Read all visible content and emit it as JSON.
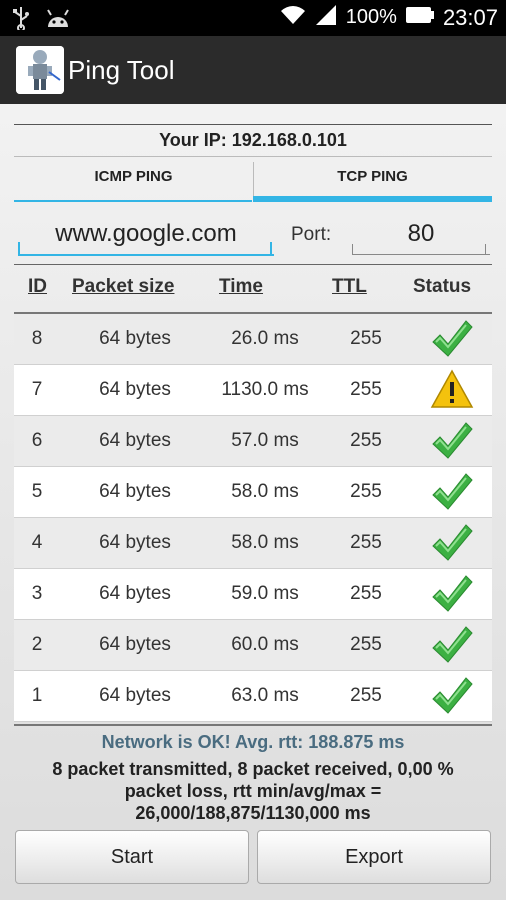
{
  "status_bar": {
    "battery_text": "100%",
    "time": "23:07",
    "icons": [
      "usb-icon",
      "android-icon",
      "wifi-icon",
      "signal-icon",
      "battery-icon"
    ]
  },
  "app": {
    "title": "Ping Tool",
    "icon_name": "robot-app-icon"
  },
  "your_ip": "Your IP: 192.168.0.101",
  "tabs": [
    {
      "label": "ICMP PING",
      "selected": false
    },
    {
      "label": "TCP PING",
      "selected": true
    }
  ],
  "host": {
    "value": "www.google.com"
  },
  "port": {
    "label": "Port:",
    "value": "80"
  },
  "table": {
    "headers": {
      "id": "ID",
      "size": "Packet size",
      "time": "Time",
      "ttl": "TTL",
      "status": "Status"
    },
    "rows": [
      {
        "id": "8",
        "size": "64 bytes",
        "time": "26.0 ms",
        "ttl": "255",
        "status": "ok"
      },
      {
        "id": "7",
        "size": "64 bytes",
        "time": "1130.0 ms",
        "ttl": "255",
        "status": "warning"
      },
      {
        "id": "6",
        "size": "64 bytes",
        "time": "57.0 ms",
        "ttl": "255",
        "status": "ok"
      },
      {
        "id": "5",
        "size": "64 bytes",
        "time": "58.0 ms",
        "ttl": "255",
        "status": "ok"
      },
      {
        "id": "4",
        "size": "64 bytes",
        "time": "58.0 ms",
        "ttl": "255",
        "status": "ok"
      },
      {
        "id": "3",
        "size": "64 bytes",
        "time": "59.0 ms",
        "ttl": "255",
        "status": "ok"
      },
      {
        "id": "2",
        "size": "64 bytes",
        "time": "60.0 ms",
        "ttl": "255",
        "status": "ok"
      },
      {
        "id": "1",
        "size": "64 bytes",
        "time": "63.0 ms",
        "ttl": "255",
        "status": "ok"
      }
    ]
  },
  "summary": "Network is OK! Avg. rtt: 188.875 ms",
  "stats": "8 packet transmitted, 8 packet received, 0,00 % packet loss, rtt min/avg/max = 26,000/188,875/1130,000 ms",
  "buttons": {
    "start": "Start",
    "export": "Export"
  },
  "colors": {
    "accent": "#33b5e5",
    "summary_text": "#4a6c80",
    "ok_green": "#3cb043",
    "warning_yellow": "#f4c20d"
  }
}
